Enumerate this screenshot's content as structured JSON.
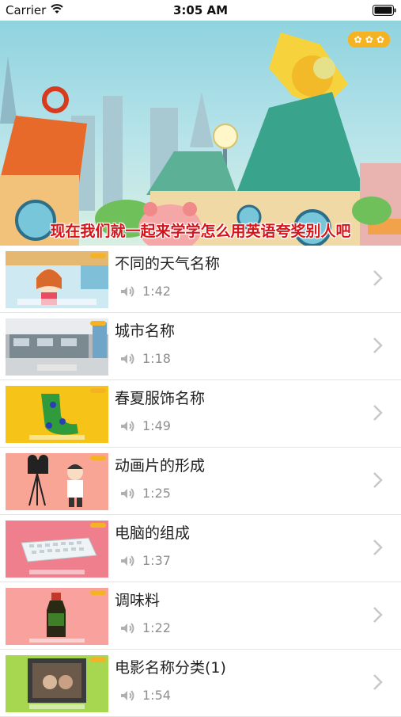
{
  "status_bar": {
    "carrier": "Carrier",
    "time": "3:05 AM"
  },
  "hero": {
    "caption": "现在我们就一起来学学怎么用英语夸奖别人吧"
  },
  "lessons": [
    {
      "title": "不同的天气名称",
      "duration": "1:42",
      "thumb_bg": "#cfe9f3"
    },
    {
      "title": "城市名称",
      "duration": "1:18",
      "thumb_bg": "#b5b9bd"
    },
    {
      "title": "春夏服饰名称",
      "duration": "1:49",
      "thumb_bg": "#f6c418"
    },
    {
      "title": "动画片的形成",
      "duration": "1:25",
      "thumb_bg": "#f8a596"
    },
    {
      "title": "电脑的组成",
      "duration": "1:37",
      "thumb_bg": "#f07f8e"
    },
    {
      "title": "调味料",
      "duration": "1:22",
      "thumb_bg": "#f9a19c"
    },
    {
      "title": "电影名称分类(1)",
      "duration": "1:54",
      "thumb_bg": "#a7d651"
    }
  ],
  "icons": {
    "speaker": "speaker-icon",
    "chevron": "chevron-right-icon",
    "wifi": "wifi-icon",
    "battery": "battery-icon"
  },
  "colors": {
    "caption": "#d6141a",
    "duration_text": "#8e8e8e",
    "chevron": "#c7c7cc"
  }
}
